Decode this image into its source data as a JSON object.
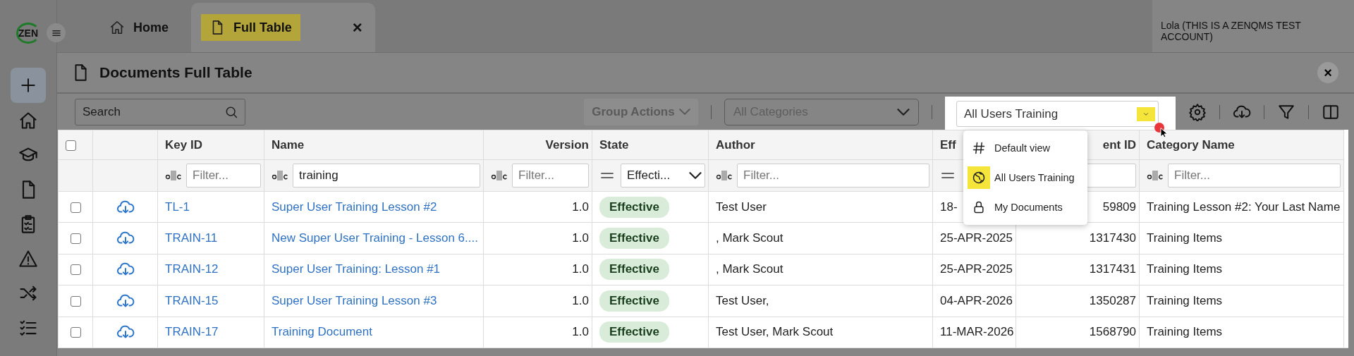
{
  "sidebar": {
    "logo": "ZEN"
  },
  "tabs": [
    {
      "label": "Home",
      "selected": false,
      "highlighted": false
    },
    {
      "label": "Full Table",
      "selected": true,
      "highlighted": true,
      "close": "×"
    }
  ],
  "user": "Lola (THIS IS A ZENQMS TEST ACCOUNT)",
  "page": {
    "title": "Documents Full Table",
    "close": "×"
  },
  "toolbar": {
    "search": {
      "placeholder": "Search"
    },
    "group_actions": "Group Actions",
    "category": "All Categories",
    "view": {
      "value": "All Users Training",
      "highlighted": true
    }
  },
  "view_menu": [
    {
      "label": "Default view",
      "highlighted": false
    },
    {
      "label": "All Users Training",
      "highlighted": true
    },
    {
      "label": "My Documents",
      "highlighted": false
    }
  ],
  "table": {
    "all_checked": false,
    "columns": [
      {
        "label": "Key ID",
        "kind": "text"
      },
      {
        "label": "Name",
        "kind": "text"
      },
      {
        "label": "Version",
        "kind": "number"
      },
      {
        "label": "State",
        "kind": "text"
      },
      {
        "label": "Author",
        "kind": "text"
      },
      {
        "label": "Eff",
        "kind": "text"
      },
      {
        "label": "ent ID",
        "kind": "number"
      },
      {
        "label": "Category Name",
        "kind": "text"
      }
    ],
    "filters": [
      {
        "kind": "text",
        "placeholder": "Filter..."
      },
      {
        "kind": "text",
        "value": "training"
      },
      {
        "kind": "text",
        "placeholder": "Filter..."
      },
      {
        "kind": "select",
        "value": "Effecti..."
      },
      {
        "kind": "text",
        "placeholder": "Filter..."
      },
      {
        "kind": "equals"
      },
      {
        "kind": "input"
      },
      {
        "kind": "text",
        "placeholder": "Filter..."
      }
    ],
    "rows": [
      {
        "checked": false,
        "cells": [
          "TL-1",
          "Super User Training Lesson #2",
          "1.0",
          "Effective",
          "Test User",
          "18-",
          "59809",
          "Training Lesson #2: Your Last Name"
        ]
      },
      {
        "checked": false,
        "cells": [
          "TRAIN-11",
          "New Super User Training - Lesson 6....",
          "1.0",
          "Effective",
          ", Mark Scout",
          "25-APR-2025",
          "1317430",
          "Training Items"
        ]
      },
      {
        "checked": false,
        "cells": [
          "TRAIN-12",
          "Super User Training: Lesson #1",
          "1.0",
          "Effective",
          ", Mark Scout",
          "25-APR-2025",
          "1317431",
          "Training Items"
        ]
      },
      {
        "checked": false,
        "cells": [
          "TRAIN-15",
          "Super User Training Lesson #3",
          "1.0",
          "Effective",
          "Test User,",
          "04-APR-2026",
          "1350287",
          "Training Items"
        ]
      },
      {
        "checked": false,
        "cells": [
          "TRAIN-17",
          "Training Document",
          "1.0",
          "Effective",
          "Test User, Mark Scout",
          "11-MAR-2026",
          "1568790",
          "Training Items"
        ]
      }
    ]
  }
}
